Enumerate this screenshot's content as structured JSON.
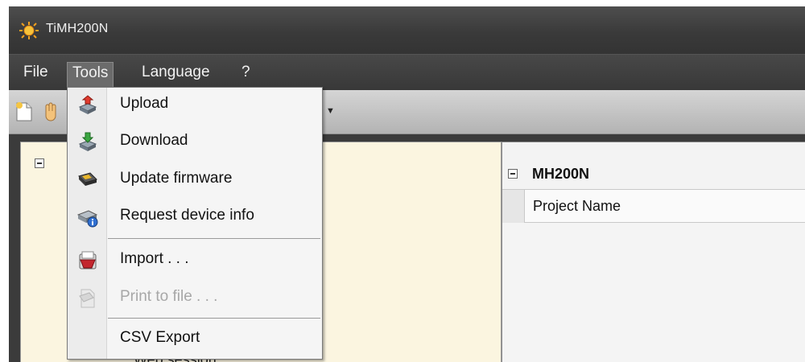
{
  "app": {
    "title": "TiMH200N",
    "icon": "sun-icon"
  },
  "menubar": {
    "items": [
      {
        "label": "File"
      },
      {
        "label": "Tools",
        "active": true
      },
      {
        "label": "Language"
      },
      {
        "label": "?"
      }
    ]
  },
  "tools_menu": {
    "items": [
      {
        "label": "Upload",
        "icon": "upload-icon",
        "enabled": true
      },
      {
        "label": "Download",
        "icon": "download-icon",
        "enabled": true
      },
      {
        "label": "Update firmware",
        "icon": "firmware-icon",
        "enabled": true
      },
      {
        "label": "Request device info",
        "icon": "device-info-icon",
        "enabled": true
      },
      {
        "label": "Import . . .",
        "icon": "import-icon",
        "enabled": true
      },
      {
        "label": "Print to file . . .",
        "icon": "print-icon",
        "enabled": false
      },
      {
        "label": "CSV Export",
        "icon": "",
        "enabled": true
      }
    ]
  },
  "tree": {
    "partial_item": "Web session"
  },
  "properties": {
    "category": "MH200N",
    "rows": [
      {
        "name": "Project Name",
        "value": ""
      }
    ]
  },
  "colors": {
    "tree_background": "#fbf5e0",
    "menubar": "#3b3b3b",
    "disabled_text": "#a7a7a7"
  }
}
